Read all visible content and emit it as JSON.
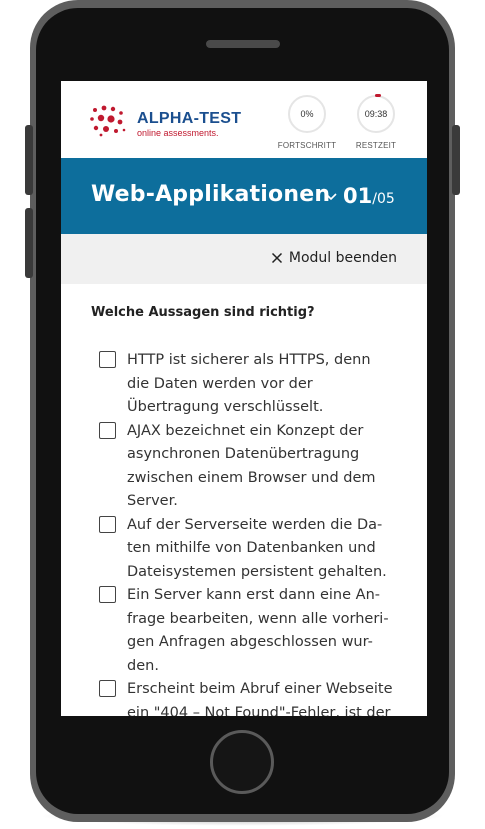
{
  "brand": {
    "title": "ALPHA-TEST",
    "subtitle": "online assessments.",
    "accent_blue": "#1b4f8f",
    "accent_red": "#c0192f"
  },
  "stats": {
    "progress": {
      "value": "0%",
      "label": "FORTSCHRITT"
    },
    "time": {
      "value": "09:38",
      "label": "RESTZEIT"
    }
  },
  "module": {
    "title": "Web-Applikationen",
    "current": "01",
    "total": "/05",
    "bar_color": "#0d6e9c",
    "chevron_icon": "chevron-down-icon"
  },
  "actions": {
    "end_module_label": "Modul beenden",
    "end_module_icon": "close-icon"
  },
  "question": {
    "text": "Welche Aussagen sind richtig?",
    "answers": [
      {
        "text": "HTTP ist sicherer als HTTPS, denn die Daten werden vor der Übertragung verschlüsselt.",
        "checked": false
      },
      {
        "text": "AJAX bezeichnet ein Konzept der asynchronen Datenübertragung zwischen einem Browser und dem Server.",
        "checked": false
      },
      {
        "text": "Auf der Serverseite werden die Da-ten mithilfe von Datenbanken und Dateisystemen persistent gehalten.",
        "checked": false
      },
      {
        "text": "Ein Server kann erst dann eine An-frage bearbeiten, wenn alle vorheri-gen Anfragen abgeschlossen wur-den.",
        "checked": false
      },
      {
        "text": "Erscheint beim Abruf einer Webseite ein \"404 – Not Found\"-Fehler, ist der",
        "checked": false
      }
    ]
  }
}
